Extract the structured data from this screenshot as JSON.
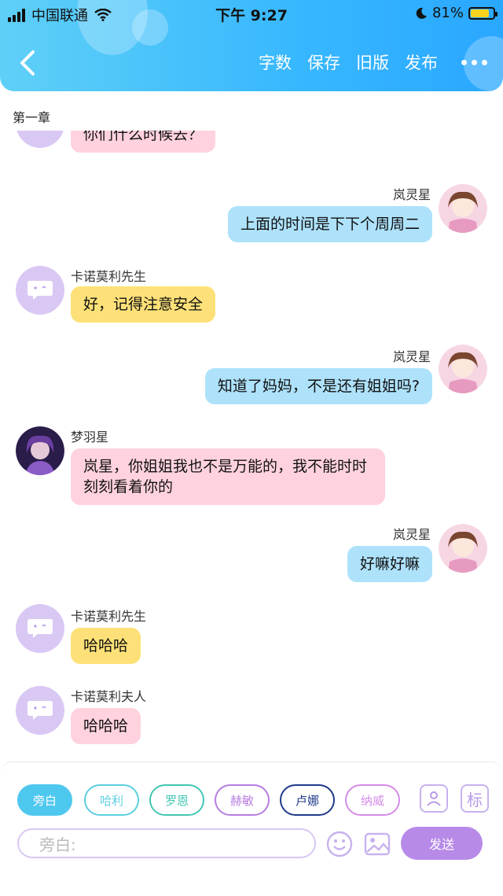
{
  "status_bar": {
    "carrier": "中国联通",
    "time": "下午 9:27",
    "battery": "81%",
    "battery_level": 0.81
  },
  "header": {
    "nav": [
      "字数",
      "保存",
      "旧版",
      "发布"
    ],
    "accent": "#37b7ff"
  },
  "chapter_title": "第一章",
  "messages": [
    {
      "side": "left",
      "name": "",
      "text": "你们什么时候去？",
      "bubble": "pink"
    },
    {
      "side": "right",
      "name": "岚灵星",
      "text": "上面的时间是下下个周周二",
      "bubble": "blue"
    },
    {
      "side": "left",
      "name": "卡诺莫利先生",
      "text": "好，记得注意安全",
      "bubble": "yellow"
    },
    {
      "side": "right",
      "name": "岚灵星",
      "text": "知道了妈妈，不是还有姐姐吗?",
      "bubble": "blue"
    },
    {
      "side": "left",
      "name": "梦羽星",
      "text": "岚星，你姐姐我也不是万能的，我不能时时刻刻看着你的",
      "bubble": "pink"
    },
    {
      "side": "right",
      "name": "岚灵星",
      "text": "好嘛好嘛",
      "bubble": "blue"
    },
    {
      "side": "left",
      "name": "卡诺莫利先生",
      "text": "哈哈哈",
      "bubble": "yellow"
    },
    {
      "side": "left",
      "name": "卡诺莫利夫人",
      "text": "哈哈哈",
      "bubble": "pink"
    }
  ],
  "characters": [
    {
      "label": "旁白",
      "color": "#4fc8f0",
      "selected": true
    },
    {
      "label": "哈利",
      "color": "#5ccfe0"
    },
    {
      "label": "罗恩",
      "color": "#43c6b4"
    },
    {
      "label": "赫敏",
      "color": "#b77de0"
    },
    {
      "label": "卢娜",
      "color": "#1f3a8a"
    },
    {
      "label": "纳威",
      "color": "#d58be8"
    }
  ],
  "tool_label": "标",
  "input": {
    "placeholder": "旁白:"
  },
  "send_label": "发送"
}
